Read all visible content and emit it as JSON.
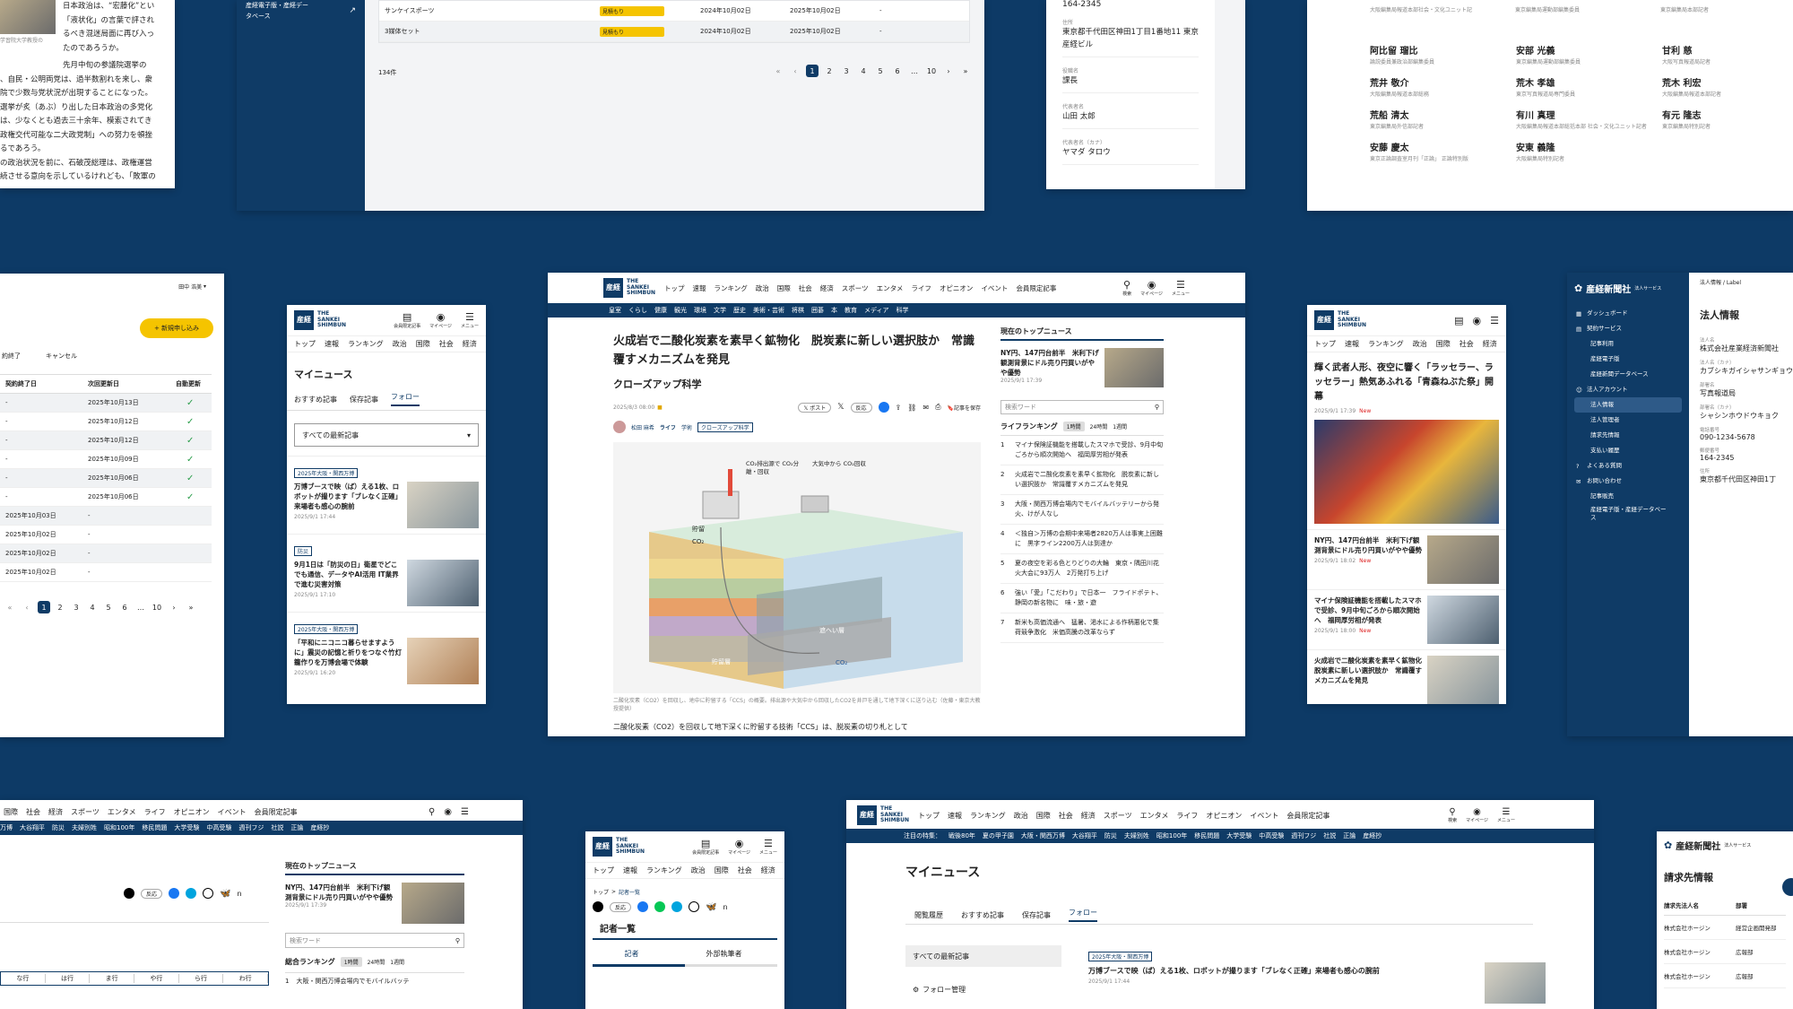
{
  "card1": {
    "caption": "学習院大学教授の",
    "lines": [
      "日本政治は、“宏藤化”とい",
      "「液状化」の言葉で評され",
      "るべき混迷局面に再び入っ",
      "たのであろうか。",
      "先月中旬の参議院選挙の",
      "、自民・公明両党は、過半数割れを来し、衆",
      "院で少数与党状況が出現することになった。",
      "選挙が炙（あぶ）り出した日本政治の多党化",
      "は、少なくとも過去三十余年、模索されてき",
      "政権交代可能な二大政党制」への努力を頓挫",
      "るであろう。",
      "の政治状況を前に、石破茂総理は、政権運営",
      "続させる意向を示しているけれども、「敗軍の"
    ]
  },
  "card2": {
    "sidebar_items": [
      "産経電子版・産経デー",
      "タベース"
    ],
    "rows": [
      {
        "name": "サンケイスポーツ",
        "status": "見積もり",
        "start": "2024年10月02日",
        "end": "2025年10月02日",
        "auto": "-"
      },
      {
        "name": "3媒体セット",
        "status": "見積もり",
        "start": "2024年10月02日",
        "end": "2025年10月02日",
        "auto": "-"
      }
    ],
    "count": "134件",
    "pages": [
      "1",
      "2",
      "3",
      "4",
      "5",
      "6",
      "…",
      "10"
    ]
  },
  "card3": {
    "zip": "164-2345",
    "fields": [
      {
        "label": "住所",
        "value": "東京都千代田区神田1丁目1番地11 東京産経ビル"
      },
      {
        "label": "役職名",
        "value": "課長"
      },
      {
        "label": "代表者名",
        "value": "山田 太郎"
      },
      {
        "label": "代表者名（カナ）",
        "value": "ヤマダ タロウ"
      }
    ]
  },
  "card4": {
    "people": [
      {
        "name": "阿比留 瑠比",
        "role": "論説委員兼政治部編集委員"
      },
      {
        "name": "安部 光義",
        "role": "東京編集局運動部編集委員"
      },
      {
        "name": "甘利 慈",
        "role": "大阪写真報道局記者"
      },
      {
        "name": "荒井 敬介",
        "role": "大阪編集局報道本部総務"
      },
      {
        "name": "荒木 孝雄",
        "role": "東京写真報道局専門委員"
      },
      {
        "name": "荒木 利宏",
        "role": "大阪編集局報道本部記者"
      },
      {
        "name": "荒船 清太",
        "role": "東京編集局外信部記者"
      },
      {
        "name": "有川 真理",
        "role": "大阪編集局報道本部総括本部 社会・文化ユニット記者"
      },
      {
        "name": "有元 隆志",
        "role": "東京編集局特別記者"
      },
      {
        "name": "安藤 慶太",
        "role": "東京正論調査室月刊「正論」 正論特別版"
      },
      {
        "name": "安東 義隆",
        "role": "大阪編集局特別記者"
      }
    ],
    "top_roles": [
      "大阪編集局報道本部社会・文化ユニット記",
      "東京編集局運動部編集委員",
      "東京編集局本部記者"
    ]
  },
  "card5": {
    "user": "田中 浩美",
    "new_button": "+ 新規申し込み",
    "tabs": [
      "約終了",
      "キャンセル"
    ],
    "headers": [
      "契約終了日",
      "次回更新日",
      "自動更新"
    ],
    "rows": [
      {
        "end": "-",
        "next": "2025年10月13日",
        "auto": "✓"
      },
      {
        "end": "-",
        "next": "2025年10月12日",
        "auto": "✓"
      },
      {
        "end": "-",
        "next": "2025年10月12日",
        "auto": "✓"
      },
      {
        "end": "-",
        "next": "2025年10月09日",
        "auto": "✓"
      },
      {
        "end": "-",
        "next": "2025年10月06日",
        "auto": "✓"
      },
      {
        "end": "-",
        "next": "2025年10月06日",
        "auto": "✓"
      },
      {
        "end": "2025年10月03日",
        "next": "-",
        "auto": ""
      },
      {
        "end": "2025年10月02日",
        "next": "-",
        "auto": ""
      },
      {
        "end": "2025年10月02日",
        "next": "-",
        "auto": ""
      },
      {
        "end": "2025年10月02日",
        "next": "-",
        "auto": ""
      }
    ],
    "pages": [
      "1",
      "2",
      "3",
      "4",
      "5",
      "6",
      "…",
      "10"
    ]
  },
  "card6": {
    "logo": "THE SANKEI SHIMBUN",
    "header_icons": [
      "会員限定記事",
      "マイページ",
      "メニュー"
    ],
    "nav": [
      "トップ",
      "速報",
      "ランキング",
      "政治",
      "国際",
      "社会",
      "経済"
    ],
    "title": "マイニュース",
    "tabs": [
      "おすすめ記事",
      "保存記事",
      "フォロー"
    ],
    "select": "すべての最新記事",
    "articles": [
      {
        "tag": "2025年大阪・関西万博",
        "title": "万博ブースで映（ば）える1枚、ロボットが撮ります「ブレなく正確」来場者も感心の腕前",
        "date": "2025/9/1 17:44"
      },
      {
        "tag": "防災",
        "title": "9月1日は「防災の日」衛星でどこでも通信、データやAI活用 IT業界で進む災害対策",
        "date": "2025/9/1 17:10"
      },
      {
        "tag": "2025年大阪・関西万博",
        "title": "「平和にニコニコ暮らせますように」震災の記憶と祈りをつなぐ竹灯籠作りを万博会場で体験",
        "date": "2025/9/1 16:20"
      }
    ]
  },
  "card7": {
    "nav": [
      "トップ",
      "速報",
      "ランキング",
      "政治",
      "国際",
      "社会",
      "経済",
      "スポーツ",
      "エンタメ",
      "ライフ",
      "オピニオン",
      "イベント",
      "会員限定記事"
    ],
    "subnav": [
      "皇室",
      "くらし",
      "健康",
      "観光",
      "環境",
      "文学",
      "歴史",
      "美術・芸術",
      "将棋",
      "囲碁",
      "本",
      "教育",
      "メディア",
      "科学"
    ],
    "header_icons": [
      "検索",
      "マイページ",
      "メニュー"
    ],
    "headline": "火成岩で二酸化炭素を素早く鉱物化　脱炭素に新しい選択肢か　常識覆すメカニズムを発見",
    "section": "クローズアップ科学",
    "date": "2025/8/3 08:00",
    "share": [
      "ポスト",
      "反応",
      "記事を保存"
    ],
    "author": "松田 麻希",
    "tags": [
      "ライフ",
      "学術",
      "クローズアップ科学"
    ],
    "diagram_labels": [
      "CO₂排出源で CO₂分離・回収",
      "大気中から CO₂回収",
      "貯留",
      "CO₂",
      "遮へい層",
      "貯留層",
      "CO₂"
    ],
    "caption": "二酸化炭素（CO2）を回収し、地中に貯留する「CCS」の概要。排出源や大気中から回収したCO2を井戸を通して地下深くに送り込む（佐藤・東京大教授提供）",
    "body_start": "二酸化炭素（CO2）を回収して地下深くに貯留する技術「CCS」は、脱炭素の切り札として",
    "top_news_title": "現在のトップニュース",
    "top_news": "NY円、147円台前半　米利下げ観測背景にドル売り円買いがやや優勢",
    "top_news_date": "2025/9/1 17:39",
    "search_placeholder": "検索ワード",
    "ranking_title": "ライフランキング",
    "ranking_tabs": [
      "1時間",
      "24時間",
      "1週間"
    ],
    "ranking": [
      "マイナ保険証機能を搭載したスマホで受診、9月中旬ごろから順次開始へ　福岡厚労相が発表",
      "火成岩で二酸化炭素を素早く鉱物化　脱炭素に新しい選択肢か　常識覆すメカニズムを発見",
      "大阪・関西万博会場内でモバイルバッテリーから発火、けが人なし",
      "＜独自＞万博の会期中来場者2820万人は事実上困難に　黒字ライン2200万人は到達か",
      "夏の夜空を彩る色とりどりの大輪　東京・隅田川花火大会に93万人　2万発打ち上げ",
      "強い「愛」「こだわり」で日本一　フライドポテト、静岡の新名物に　味・旅・遊",
      "新米も高価流通へ　猛暑、渇水による作柄悪化で集荷競争激化　米価高騰の改革ならず"
    ]
  },
  "card8": {
    "nav": [
      "トップ",
      "速報",
      "ランキング",
      "政治",
      "国際",
      "社会",
      "経済"
    ],
    "headline": "輝く武者人形、夜空に響く「ラッセラー、ラッセラー」熱気あふれる「青森ねぶた祭」開幕",
    "date": "2025/9/1 17:39",
    "new": "New",
    "items": [
      {
        "title": "NY円、147円台前半　米利下げ観測背景にドル売り円買いがやや優勢",
        "date": "2025/9/1 18:02"
      },
      {
        "title": "マイナ保険証機能を搭載したスマホで受診、9月中旬ごろから順次開始へ　福岡厚労相が発表",
        "date": "2025/9/1 18:00"
      },
      {
        "title": "火成岩で二酸化炭素を素早く鉱物化　脱炭素に新しい選択肢か　常識覆すメカニズムを発見",
        "date": ""
      }
    ]
  },
  "card9": {
    "brand": "産経新聞社",
    "brand_sub": "法人サービス",
    "menu": [
      {
        "label": "ダッシュボード",
        "level": 0
      },
      {
        "label": "契約サービス",
        "level": 0
      },
      {
        "label": "記事利用",
        "level": 1
      },
      {
        "label": "産経電子版",
        "level": 1
      },
      {
        "label": "産経新聞データベース",
        "level": 1
      },
      {
        "label": "法人アカウント",
        "level": 0
      },
      {
        "label": "法人情報",
        "level": 1,
        "active": true
      },
      {
        "label": "法人管理者",
        "level": 1
      },
      {
        "label": "請求先情報",
        "level": 1
      },
      {
        "label": "支払い履歴",
        "level": 1
      },
      {
        "label": "よくある質問",
        "level": 0
      },
      {
        "label": "お問い合わせ",
        "level": 0
      },
      {
        "label": "記事販売",
        "level": 1
      },
      {
        "label": "産経電子版・産経データベース",
        "level": 1
      }
    ],
    "breadcrumb": "法人情報 / Label",
    "title": "法人情報",
    "fields": [
      {
        "label": "法人名",
        "value": "株式会社産業経済新聞社"
      },
      {
        "label": "法人名（カナ）",
        "value": "カブシキガイシャサンギョウ"
      },
      {
        "label": "部署名",
        "value": "写真報道局"
      },
      {
        "label": "部署名（カナ）",
        "value": "シャシンホウドウキョク"
      },
      {
        "label": "電話番号",
        "value": "090-1234-5678"
      },
      {
        "label": "郵便番号",
        "value": "164-2345"
      },
      {
        "label": "住所",
        "value": "東京都千代田区神田1丁"
      }
    ]
  },
  "card10": {
    "nav": [
      "国際",
      "社会",
      "経済",
      "スポーツ",
      "エンタメ",
      "ライフ",
      "オピニオン",
      "イベント",
      "会員限定記事"
    ],
    "subnav": [
      "万博",
      "大谷翔平",
      "防災",
      "夫婦別姓",
      "昭和100年",
      "移民問題",
      "大学受験",
      "中高受験",
      "週刊フジ",
      "社説",
      "正論",
      "産経抄"
    ],
    "header_icons": [
      "検索",
      "マイページ",
      "メニュー"
    ],
    "kana_tabs": [
      "な行",
      "は行",
      "ま行",
      "や行",
      "ら行",
      "わ行"
    ],
    "react": "反応",
    "top_news_title": "現在のトップニュース",
    "top_news": "NY円、147円台前半　米利下げ観測背景にドル売り円買いがやや優勢",
    "top_news_date": "2025/9/1 17:39",
    "search_placeholder": "検索ワード",
    "ranking_title": "総合ランキング",
    "ranking_tabs": [
      "1時間",
      "24時間",
      "1週間"
    ],
    "ranking_first": "大阪・関西万博会場内でモバイルバッテ"
  },
  "card11": {
    "header_icons": [
      "会員限定記事",
      "マイページ",
      "メニュー"
    ],
    "nav": [
      "トップ",
      "速報",
      "ランキング",
      "政治",
      "国際",
      "社会",
      "経済"
    ],
    "breadcrumb": [
      "トップ",
      "記者一覧"
    ],
    "react": "反応",
    "title": "記者一覧",
    "tabs": [
      "記者",
      "外部執筆者"
    ]
  },
  "card12": {
    "nav": [
      "トップ",
      "速報",
      "ランキング",
      "政治",
      "国際",
      "社会",
      "経済",
      "スポーツ",
      "エンタメ",
      "ライフ",
      "オピニオン",
      "イベント",
      "会員限定記事"
    ],
    "subnav": [
      "注目の特集：",
      "戦後80年",
      "夏の甲子園",
      "大阪・関西万博",
      "大谷翔平",
      "防災",
      "夫婦別姓",
      "昭和100年",
      "移民問題",
      "大学受験",
      "中高受験",
      "週刊フジ",
      "社説",
      "正論",
      "産経抄"
    ],
    "header_icons": [
      "検索",
      "マイページ",
      "メニュー"
    ],
    "title": "マイニュース",
    "tabs": [
      "閲覧履歴",
      "おすすめ記事",
      "保存記事",
      "フォロー"
    ],
    "side": [
      "すべての最新記事",
      "フォロー管理"
    ],
    "tag": "2025年大阪・関西万博",
    "article": "万博ブースで映（ば）える1枚、ロボットが撮ります「ブレなく正確」来場者も感心の腕前",
    "date": "2025/9/1 17:44"
  },
  "card13": {
    "brand": "産経新聞社",
    "brand_sub": "法人サービス",
    "title": "請求先情報",
    "headers": [
      "請求先法人名",
      "部署"
    ],
    "rows": [
      {
        "name": "株式会社ホージン",
        "dept": "経営企画開発部"
      },
      {
        "name": "株式会社ホージン",
        "dept": "広報部"
      },
      {
        "name": "株式会社ホージン",
        "dept": "広報部"
      }
    ]
  }
}
